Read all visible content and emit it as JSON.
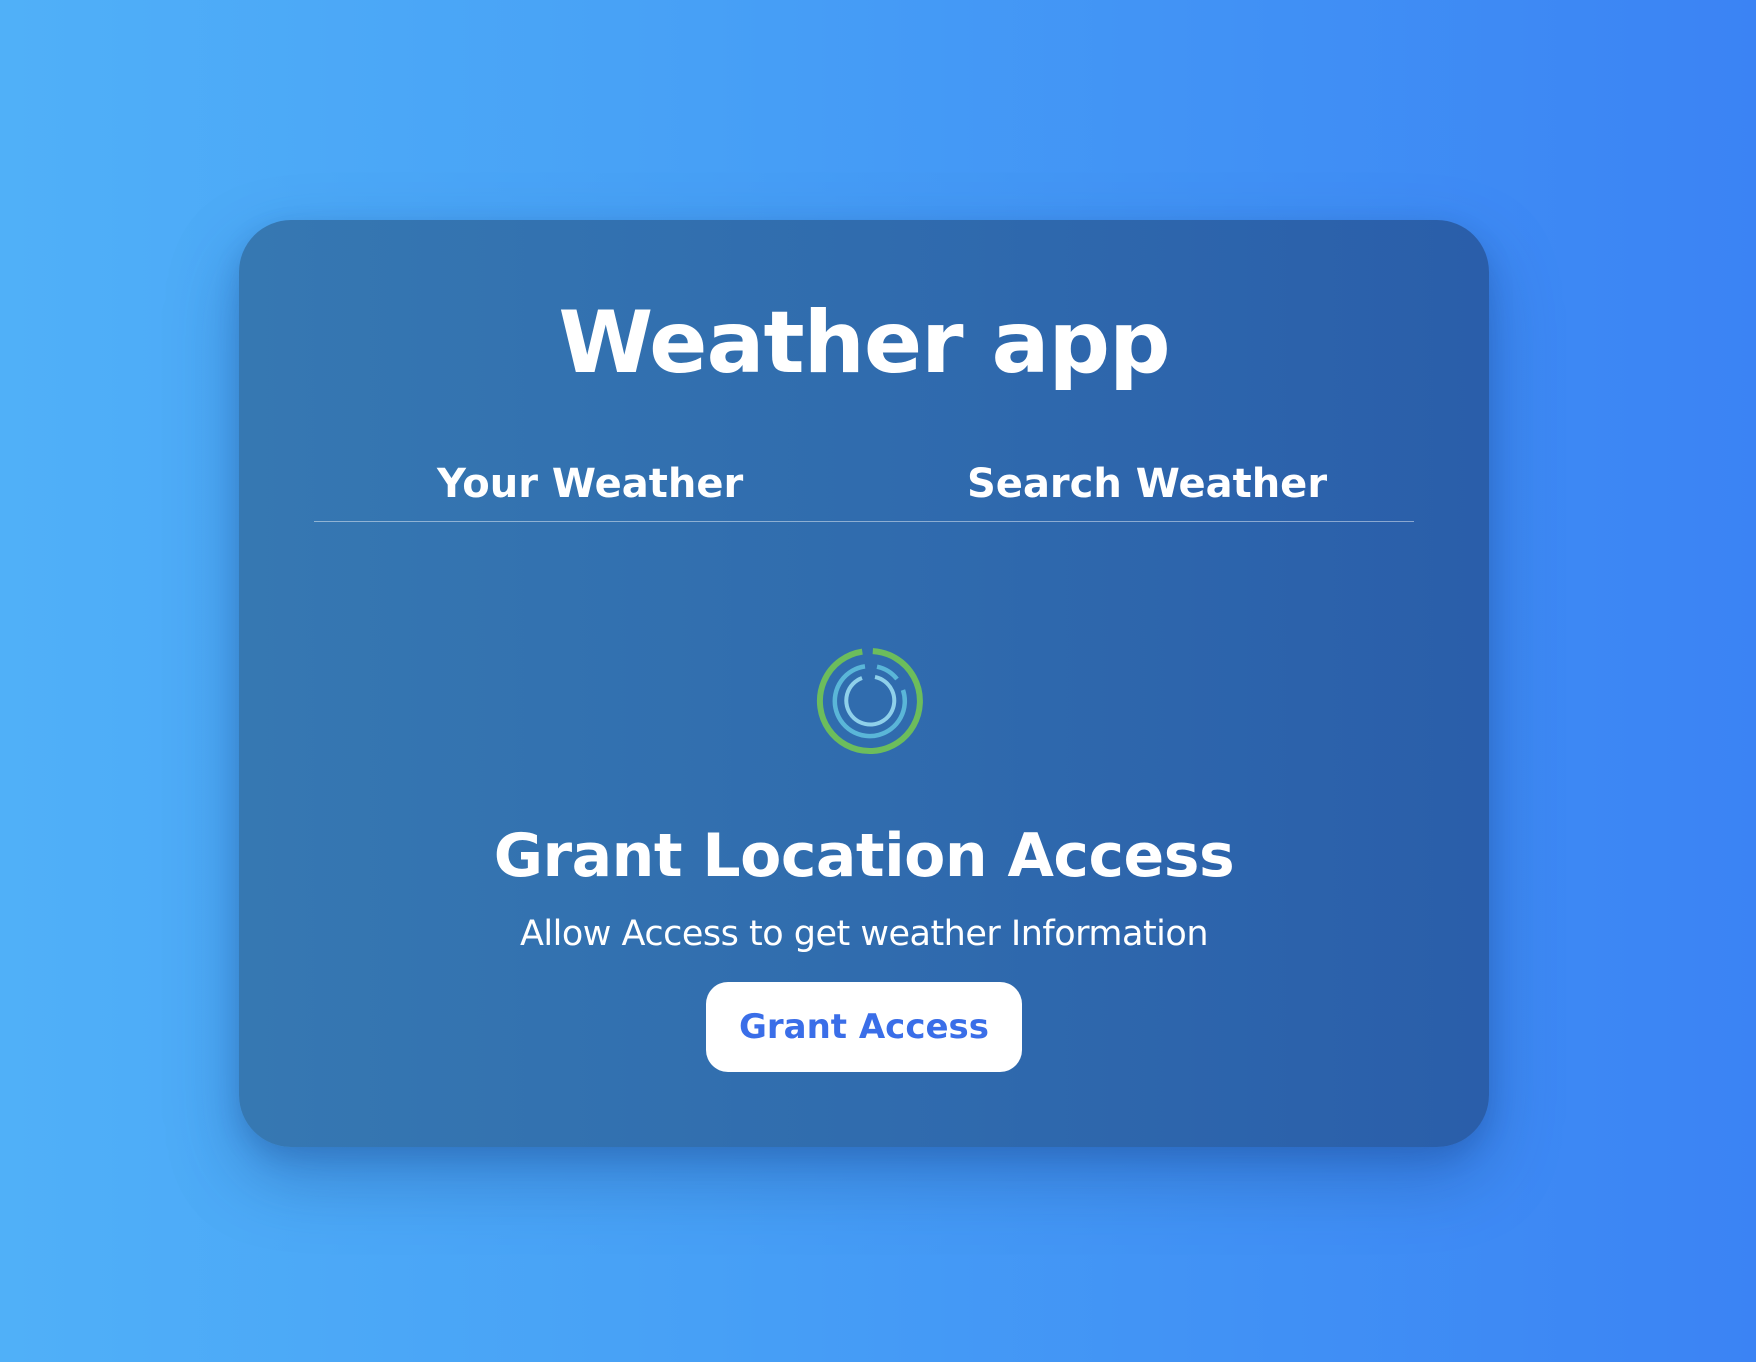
{
  "header": {
    "title": "Weather app"
  },
  "tabs": [
    {
      "label": "Your Weather"
    },
    {
      "label": "Search Weather"
    }
  ],
  "loader": {
    "icon": "loading-spinner-icon",
    "colors": {
      "outer": "#6cbd5c",
      "inner": "#5ab6d8"
    }
  },
  "grant_access": {
    "title": "Grant Location Access",
    "subtitle": "Allow Access to get weather Information",
    "button_label": "Grant Access",
    "button_text_color": "#3a6ee8"
  },
  "colors": {
    "background_start": "#50b0f8",
    "background_end": "#3b83f4",
    "card": "#306cae"
  }
}
